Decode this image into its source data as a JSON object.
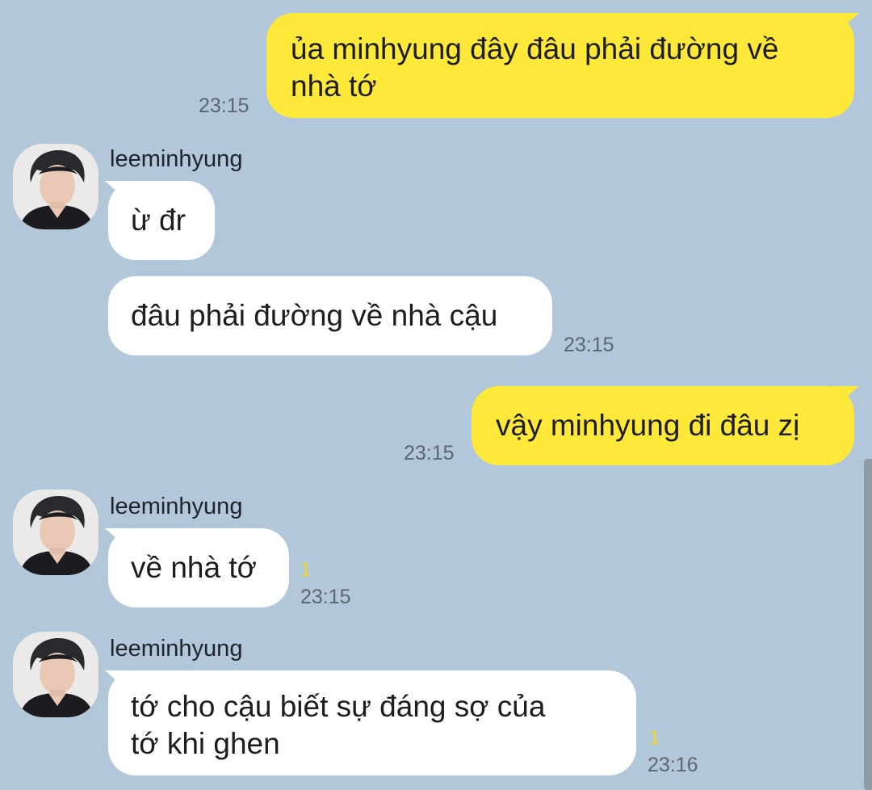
{
  "messages": [
    {
      "type": "out",
      "text": "ủa minhyung đây đâu phải đường về\nnhà tớ",
      "time": "23:15"
    },
    {
      "type": "in",
      "sender": "leeminhyung",
      "text": "ừ đr"
    },
    {
      "type": "in",
      "text": "đâu phải đường về nhà cậu",
      "time": "23:15"
    },
    {
      "type": "out",
      "text": "vậy minhyung đi đâu zị",
      "time": "23:15"
    },
    {
      "type": "in",
      "sender": "leeminhyung",
      "text": "về nhà tớ",
      "unread": "1",
      "time": "23:15"
    },
    {
      "type": "in",
      "sender": "leeminhyung",
      "text": "tớ cho cậu biết sự đáng sợ của\ntớ khi ghen",
      "unread": "1",
      "time": "23:16"
    }
  ],
  "colors": {
    "background": "#b2c7da",
    "outgoing_bubble": "#fee83a",
    "incoming_bubble": "#ffffff",
    "unread_count": "#f5d51f",
    "timestamp": "#5b6670"
  },
  "icons": {
    "avatar": "profile-photo-avatar"
  }
}
